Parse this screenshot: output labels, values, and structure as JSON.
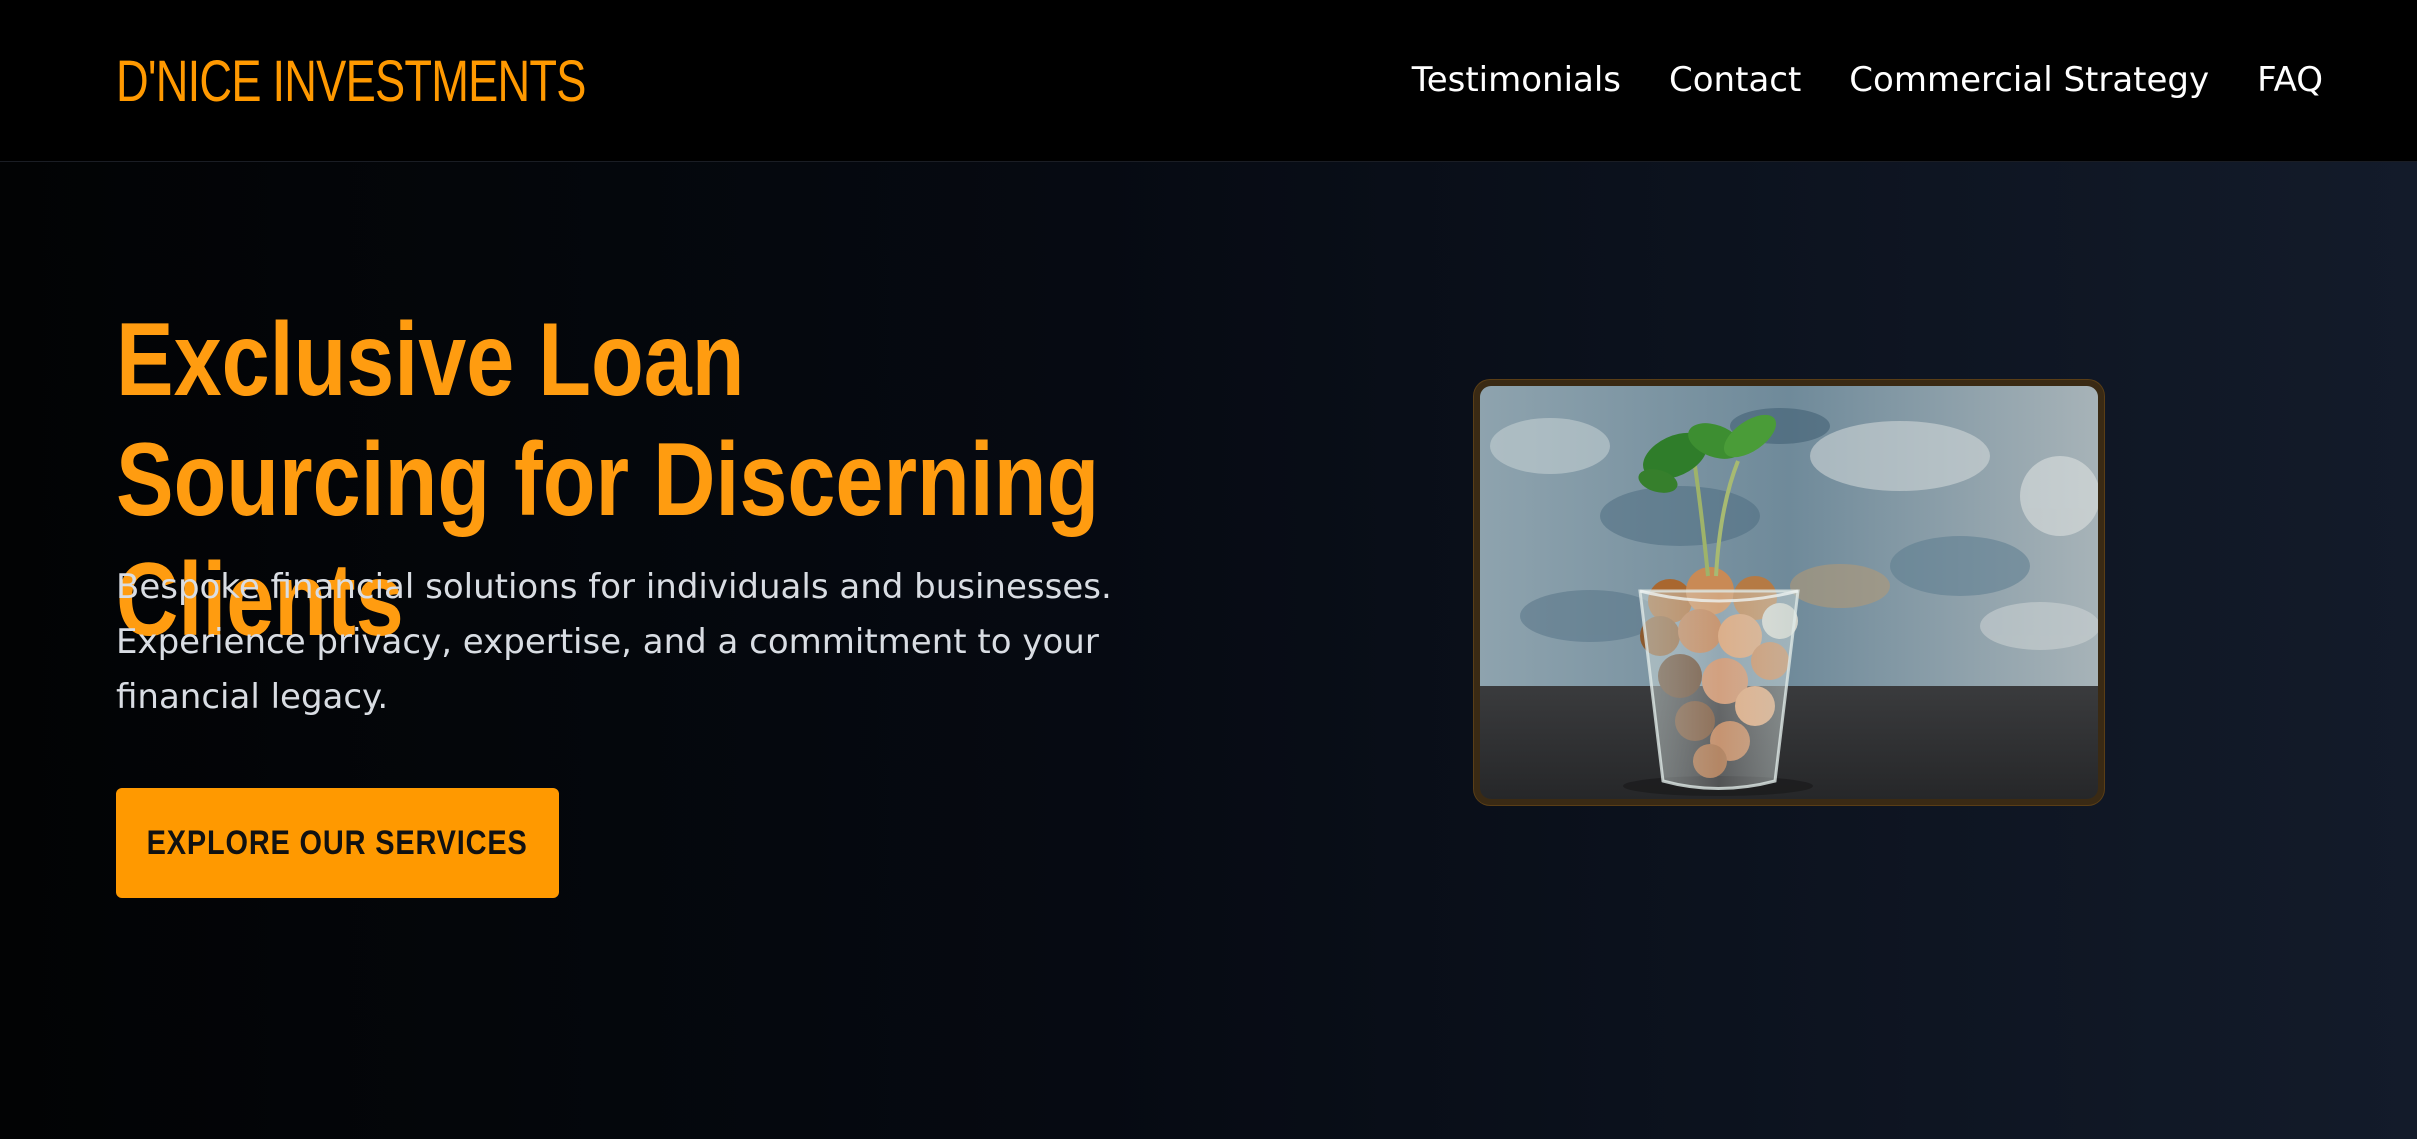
{
  "header": {
    "logo": "D'NICE INVESTMENTS",
    "nav": [
      {
        "label": "Testimonials"
      },
      {
        "label": "Contact"
      },
      {
        "label": "Commercial Strategy"
      },
      {
        "label": "FAQ"
      }
    ]
  },
  "hero": {
    "title": "Exclusive Loan Sourcing for Discerning Clients",
    "subtitle": "Bespoke financial solutions for individuals and businesses. Experience privacy, expertise, and a commitment to your financial legacy.",
    "cta_label": "EXPLORE OUR SERVICES",
    "image": {
      "icon": "coin-jar-plant-photo"
    }
  },
  "colors": {
    "accent": "#ff9900",
    "background": "#000000",
    "nav_text": "#ffffff",
    "body_text": "#d9dde3"
  }
}
